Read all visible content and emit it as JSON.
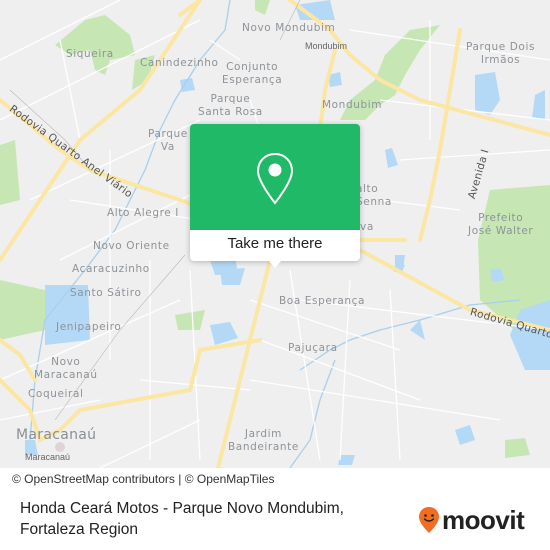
{
  "map": {
    "colors": {
      "land": "#efefef",
      "park": "#c6e7b4",
      "water": "#b4d9f7",
      "major_road": "#fbe6a3",
      "minor_road": "#ffffff",
      "label": "#8e9398"
    },
    "neighborhood_labels": [
      {
        "name": "Siqueira"
      },
      {
        "name": "Canindezinho"
      },
      {
        "name": "Novo Mondubim"
      },
      {
        "name": "Mondubim"
      },
      {
        "name": "Conjunto\nEsperança"
      },
      {
        "name": "Parque\nSanta Rosa"
      },
      {
        "name": "Parque\nVa"
      },
      {
        "name": "Mondubim"
      },
      {
        "name": "Parque Dois\nIrmãos"
      },
      {
        "name": "Alto Alegre I"
      },
      {
        "name": "Novo Oriente"
      },
      {
        "name": "Acaracuzinho"
      },
      {
        "name": "Santo Sátiro"
      },
      {
        "name": "Jenipapeiro"
      },
      {
        "name": "Novo\nMaracanaú"
      },
      {
        "name": "Coqueiral"
      },
      {
        "name": "Maracanaú"
      },
      {
        "name": "Maracanaú"
      },
      {
        "name": "alto\nSenna"
      },
      {
        "name": "va"
      },
      {
        "name": "Prefeito\nJosé Walter"
      },
      {
        "name": "Boa Esperança"
      },
      {
        "name": "Pajuçara"
      },
      {
        "name": "Jardim\nBandeirante"
      }
    ],
    "road_labels": [
      {
        "name": "Rodovia Quarto Anel Viário"
      },
      {
        "name": "Rodovia Quarto"
      },
      {
        "name": "Avenida I"
      }
    ],
    "popup": {
      "icon": "map-pin-icon",
      "button_label": "Take me there",
      "color": "#1fb967"
    }
  },
  "attribution": "© OpenStreetMap contributors | © OpenMapTiles",
  "footer": {
    "title_line1": "Honda Ceará Motos - Parque Novo Mondubim,",
    "title_line2": "Fortaleza Region",
    "logo_text": "moovit",
    "logo_icon": "moovit-smile-pin-icon",
    "logo_color": "#f26c21"
  }
}
